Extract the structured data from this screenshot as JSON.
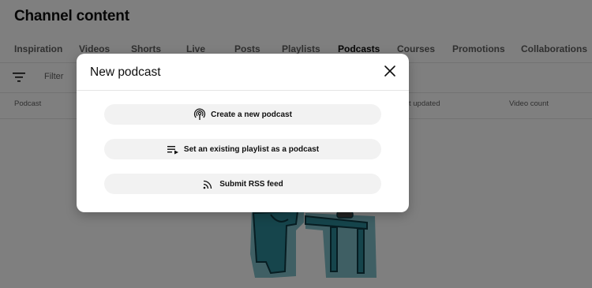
{
  "page": {
    "title": "Channel content",
    "tabs": [
      {
        "label": "Inspiration"
      },
      {
        "label": "Videos"
      },
      {
        "label": "Shorts"
      },
      {
        "label": "Live"
      },
      {
        "label": "Posts"
      },
      {
        "label": "Playlists"
      },
      {
        "label": "Podcasts",
        "active": true
      },
      {
        "label": "Courses"
      },
      {
        "label": "Promotions"
      },
      {
        "label": "Collaborations"
      }
    ],
    "filter": {
      "label": "Filter",
      "icon": "filter-icon"
    },
    "columns": {
      "podcast": "Podcast",
      "last_updated": "t updated",
      "video_count": "Video count"
    }
  },
  "dialog": {
    "title": "New podcast",
    "close_icon": "close-icon",
    "options": [
      {
        "label": "Create a new podcast",
        "icon": "podcast-icon"
      },
      {
        "label": "Set an existing playlist as a podcast",
        "icon": "playlist-icon"
      },
      {
        "label": "Submit RSS feed",
        "icon": "rss-icon"
      }
    ]
  },
  "colors": {
    "scrim": "rgba(0,0,0,0.5)",
    "button_bg": "#f2f2f2",
    "illustration_teal": "#2c8a99"
  }
}
